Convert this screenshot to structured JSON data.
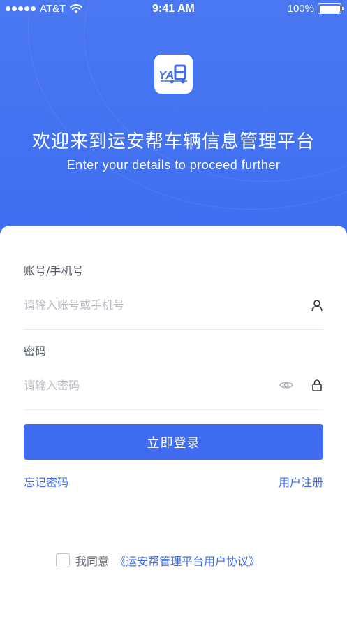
{
  "status_bar": {
    "carrier": "AT&T",
    "time": "9:41 AM",
    "battery": "100%"
  },
  "header": {
    "title": "欢迎来到运安帮车辆信息管理平台",
    "subtitle": "Enter your details to proceed further"
  },
  "form": {
    "account_label": "账号/手机号",
    "account_placeholder": "请输入账号或手机号",
    "account_value": "",
    "password_label": "密码",
    "password_placeholder": "请输入密码",
    "password_value": ""
  },
  "actions": {
    "login_label": "立即登录",
    "forgot_password": "忘记密码",
    "register": "用户注册"
  },
  "agreement": {
    "checked": false,
    "prefix": "我同意",
    "link_text": "《运安帮管理平台用户协议》"
  },
  "colors": {
    "brand": "#3f6cf1",
    "header_bg": "#4a78f2"
  },
  "icons": {
    "logo": "yab-logo-icon",
    "account": "user-icon",
    "password_visibility": "eye-icon",
    "password": "lock-icon",
    "signal": "signal-dots-icon",
    "wifi": "wifi-icon",
    "battery": "battery-icon"
  }
}
